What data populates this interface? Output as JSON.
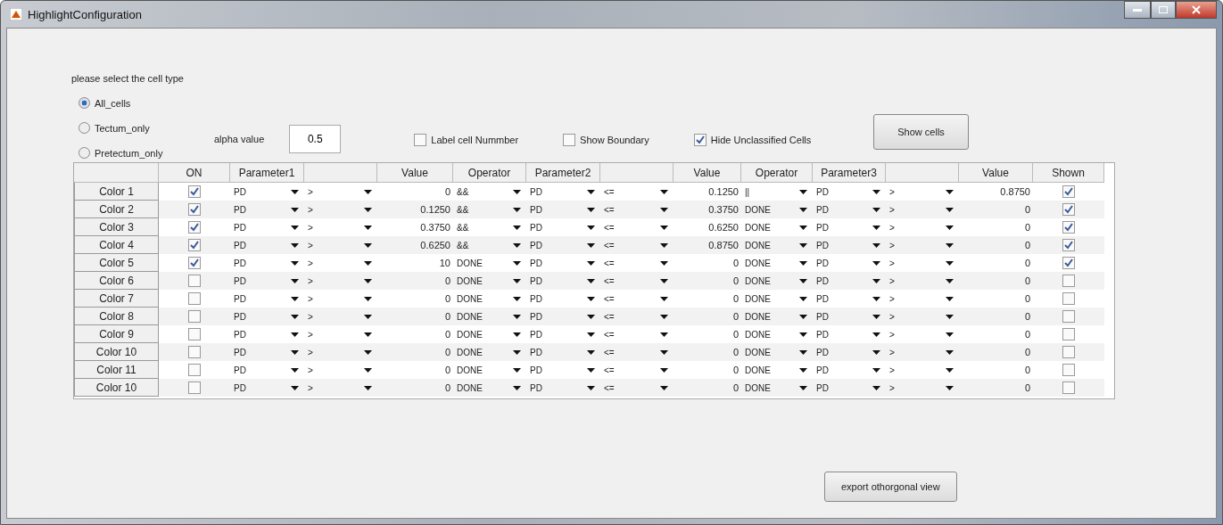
{
  "window": {
    "title": "HighlightConfiguration"
  },
  "cell_type": {
    "label": "please select the cell type",
    "options": [
      {
        "label": "All_cells",
        "selected": true
      },
      {
        "label": "Tectum_only",
        "selected": false
      },
      {
        "label": "Pretectum_only",
        "selected": false
      }
    ]
  },
  "alpha": {
    "label": "alpha value",
    "value": "0.5"
  },
  "checkboxes": [
    {
      "label": "Label cell Nummber",
      "checked": false
    },
    {
      "label": "Show Boundary",
      "checked": false
    },
    {
      "label": "Hide Unclassified Cells",
      "checked": true
    }
  ],
  "show_button": "Show cells",
  "table": {
    "columns": [
      "ON",
      "Parameter1",
      "",
      "Value",
      "Operator",
      "Parameter2",
      "",
      "Value",
      "Operator",
      "Parameter3",
      "",
      "Value",
      "Shown"
    ],
    "rows": [
      {
        "name": "Color 1",
        "on": true,
        "cells": [
          "PD",
          ">",
          "0",
          "&&",
          "PD",
          "<=",
          "0.1250",
          "||",
          "PD",
          ">",
          "0.8750"
        ],
        "shown": true
      },
      {
        "name": "Color 2",
        "on": true,
        "cells": [
          "PD",
          ">",
          "0.1250",
          "&&",
          "PD",
          "<=",
          "0.3750",
          "DONE",
          "PD",
          ">",
          "0"
        ],
        "shown": true
      },
      {
        "name": "Color 3",
        "on": true,
        "cells": [
          "PD",
          ">",
          "0.3750",
          "&&",
          "PD",
          "<=",
          "0.6250",
          "DONE",
          "PD",
          ">",
          "0"
        ],
        "shown": true
      },
      {
        "name": "Color 4",
        "on": true,
        "cells": [
          "PD",
          ">",
          "0.6250",
          "&&",
          "PD",
          "<=",
          "0.8750",
          "DONE",
          "PD",
          ">",
          "0"
        ],
        "shown": true
      },
      {
        "name": "Color 5",
        "on": true,
        "cells": [
          "PD",
          ">",
          "10",
          "DONE",
          "PD",
          "<=",
          "0",
          "DONE",
          "PD",
          ">",
          "0"
        ],
        "shown": true
      },
      {
        "name": "Color 6",
        "on": false,
        "cells": [
          "PD",
          ">",
          "0",
          "DONE",
          "PD",
          "<=",
          "0",
          "DONE",
          "PD",
          ">",
          "0"
        ],
        "shown": false
      },
      {
        "name": "Color 7",
        "on": false,
        "cells": [
          "PD",
          ">",
          "0",
          "DONE",
          "PD",
          "<=",
          "0",
          "DONE",
          "PD",
          ">",
          "0"
        ],
        "shown": false
      },
      {
        "name": "Color 8",
        "on": false,
        "cells": [
          "PD",
          ">",
          "0",
          "DONE",
          "PD",
          "<=",
          "0",
          "DONE",
          "PD",
          ">",
          "0"
        ],
        "shown": false
      },
      {
        "name": "Color 9",
        "on": false,
        "cells": [
          "PD",
          ">",
          "0",
          "DONE",
          "PD",
          "<=",
          "0",
          "DONE",
          "PD",
          ">",
          "0"
        ],
        "shown": false
      },
      {
        "name": "Color 10",
        "on": false,
        "cells": [
          "PD",
          ">",
          "0",
          "DONE",
          "PD",
          "<=",
          "0",
          "DONE",
          "PD",
          ">",
          "0"
        ],
        "shown": false
      },
      {
        "name": "Color 11",
        "on": false,
        "cells": [
          "PD",
          ">",
          "0",
          "DONE",
          "PD",
          "<=",
          "0",
          "DONE",
          "PD",
          ">",
          "0"
        ],
        "shown": false
      },
      {
        "name": "Color 10",
        "on": false,
        "cells": [
          "PD",
          ">",
          "0",
          "DONE",
          "PD",
          "<=",
          "0",
          "DONE",
          "PD",
          ">",
          "0"
        ],
        "shown": false
      }
    ]
  },
  "export_button": "export othorgonal view"
}
